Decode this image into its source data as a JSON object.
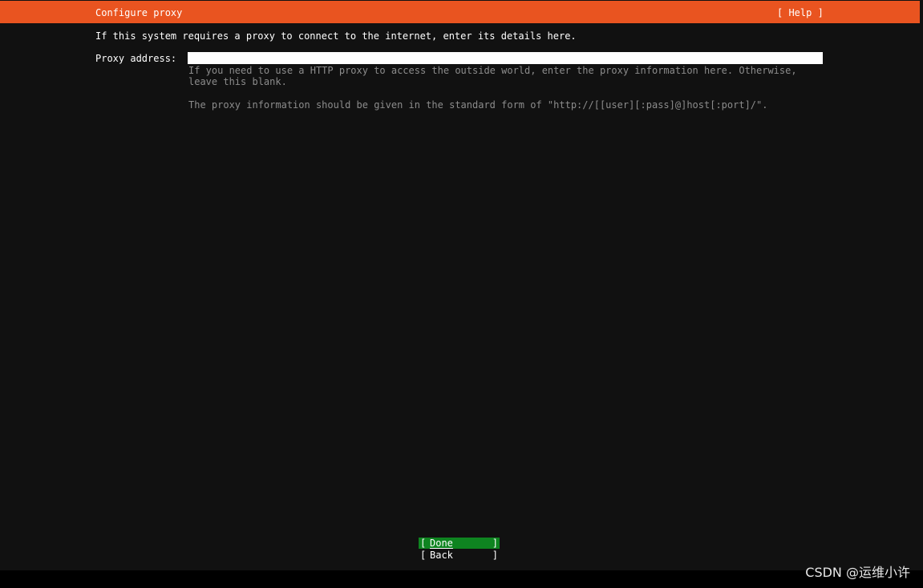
{
  "header": {
    "title": "Configure proxy",
    "help_label": "[ Help ]"
  },
  "intro_text": "If this system requires a proxy to connect to the internet, enter its details here.",
  "proxy_field": {
    "label": "Proxy address:",
    "value": "",
    "help_lines": [
      "If you need to use a HTTP proxy to access the outside world, enter the proxy information here. Otherwise,",
      "leave this blank.",
      "The proxy information should be given in the standard form of \"http://[[user][:pass]@]host[:port]/\"."
    ]
  },
  "buttons": {
    "done": {
      "open": "[",
      "label": "Done",
      "close": "]"
    },
    "back": {
      "open": "[",
      "label": "Back",
      "close": "]"
    }
  },
  "watermark": "CSDN @运维小许",
  "colors": {
    "title_bar": "#e95420",
    "selected_button": "#0e8420",
    "background": "#111111",
    "help_text": "#8c8c8c"
  }
}
